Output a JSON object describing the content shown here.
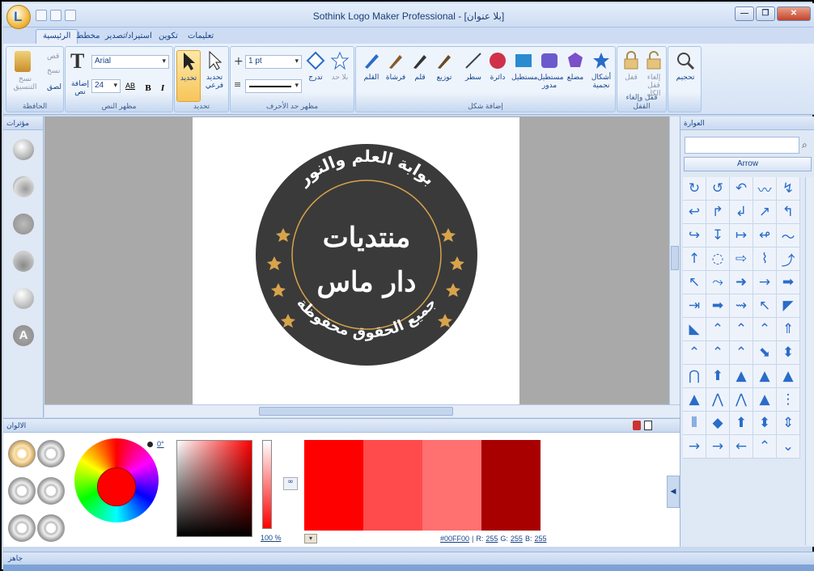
{
  "window": {
    "title": "Sothink Logo Maker Professional - [بلا عنوان]"
  },
  "tabs": [
    "الرئيسية",
    "مخطط",
    "استيراد/تصدير",
    "تكوين",
    "تعليمات"
  ],
  "ribbon": {
    "groups": [
      "الحافظة",
      "مظهر النص",
      "تحديد",
      "مظهر حد الأحرف",
      "إضافة شكل",
      "قفل وإلغاء القفل"
    ],
    "clipboard": {
      "cut": "قص",
      "copy": "نسخ",
      "paste": "لصق",
      "format_copy": "نسخ التنسيق"
    },
    "text": {
      "add_text": "إضافة نص",
      "font": "Arial",
      "size": "24",
      "bold": "B",
      "italic": "I",
      "ab": "AB"
    },
    "select": {
      "select": "تحديد",
      "sub_select": "تحديد فرعي"
    },
    "stroke": {
      "width": "1 pt",
      "color": "تدرج",
      "none": "بلا حد"
    },
    "shapes": {
      "pen": "القلم",
      "brush": "فرشاة",
      "pencil": "قلم",
      "distribute": "توزيع",
      "line": "سطر",
      "circle": "دائرة",
      "rect": "مستطيل",
      "rounded": "مستطيل مدور",
      "polygon": "مضلع",
      "star": "أشكال نجمية"
    },
    "lock": {
      "lock": "قفل",
      "unlock": "إلغاء قفل الكل"
    },
    "zoom": "تحجيم"
  },
  "left_panel": {
    "title": "مؤثرات"
  },
  "right_panel": {
    "title": "العوارة",
    "shape_category": "Arrow",
    "shape_icons": [
      "↻",
      "↺",
      "↶",
      "〰",
      "↯",
      "↩",
      "↱",
      "↲",
      "↗",
      "↰",
      "↪",
      "↧",
      "↦",
      "↫",
      "〜",
      "↑",
      "◌",
      "⇨",
      "⌇",
      "⤴",
      "↖",
      "⤳",
      "➜",
      "→",
      "➡",
      "⇥",
      "➡",
      "⇝",
      "↖",
      "◤",
      "◣",
      "⌃",
      "⌃",
      "⌃",
      "⇑",
      "⌃",
      "⌃",
      "⌃",
      "⬊",
      "⬍",
      "⋂",
      "⬆",
      "▲",
      "▲",
      "▲",
      "▲",
      "⋀",
      "⋀",
      "▲",
      "⋮",
      "⫴",
      "◆",
      "⬆",
      "⬍",
      "⇕",
      "→",
      "→",
      "←",
      "⌃",
      "⌄"
    ]
  },
  "logo": {
    "top_text": "بوابة العلم والنور",
    "center_line1": "منتديات",
    "center_line2": "دار ماس",
    "bottom_text": "جميع الحقوق محفوظة"
  },
  "colors": {
    "title": "الالوان",
    "angle": "0°",
    "opacity": "100 %",
    "hex": "#00FF00",
    "r_label": "R:",
    "r": "255",
    "g_label": "G:",
    "g": "255",
    "b_label": "B:",
    "b": "255",
    "swatches": [
      "#ff0000",
      "#ff4b4b",
      "#ff7070",
      "#a80000"
    ],
    "badge_bg": "#3a3a3a",
    "accent_gold": "#d7a44b"
  },
  "status": {
    "text": "جاهز"
  }
}
